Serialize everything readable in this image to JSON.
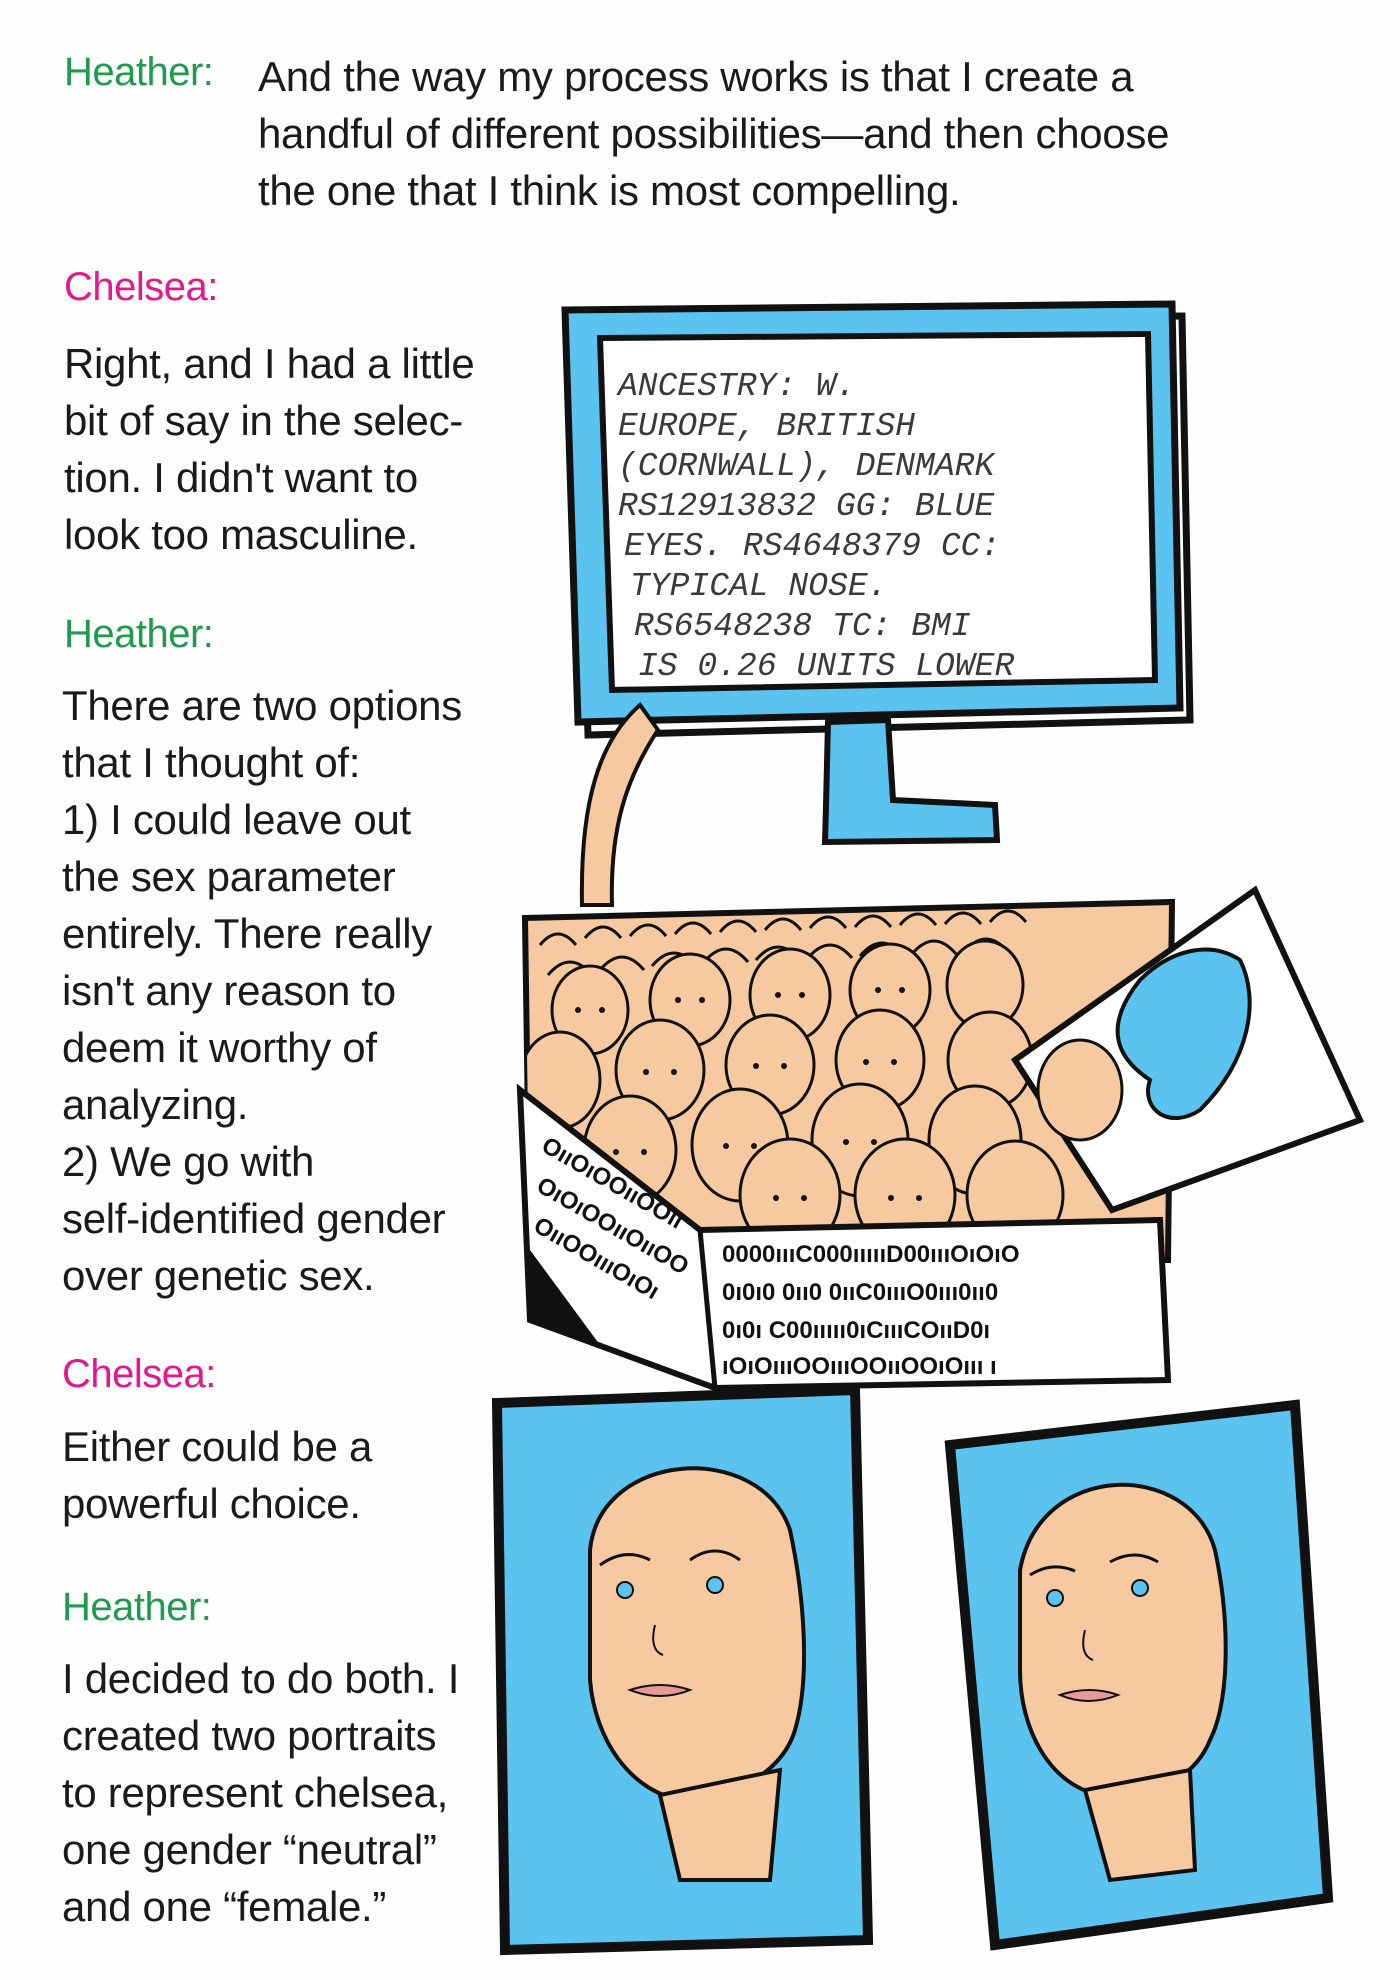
{
  "top": {
    "speaker": "Heather:",
    "lines": [
      "And the way my process works is that I create a",
      "handful of different possibilities—and then choose",
      "the one that I think is most compelling."
    ]
  },
  "dialogue": [
    {
      "speaker": "Chelsea:",
      "lines": [
        "Right, and I had a little",
        "bit of say in the selec-",
        "tion. I didn't want to",
        "look too masculine."
      ]
    },
    {
      "speaker": "Heather:",
      "lines": [
        "There are two options",
        "that I thought of:",
        "1) I could leave out",
        "the sex parameter",
        "entirely. There really",
        "isn't any reason to",
        "deem it worthy of",
        "analyzing.",
        "2) We go with",
        "self-identified gender",
        "over genetic sex."
      ]
    },
    {
      "speaker": "Chelsea:",
      "lines": [
        "Either could be a",
        "powerful choice."
      ]
    },
    {
      "speaker": "Heather:",
      "lines": [
        "I decided to do both. I",
        "created two portraits",
        "to represent chelsea,",
        "one gender “neutral”",
        "and one “female.”"
      ]
    }
  ],
  "monitor_text": [
    "ANCESTRY: W.",
    "EUROPE, BRITISH",
    "(CORNWALL), DENMARK",
    "RS12913832 GG: BLUE",
    "EYES. RS4648379 CC:",
    "TYPICAL NOSE.",
    "RS6548238 TC:  BMI",
    "IS 0.26 UNITS LOWER"
  ],
  "binary_rows": [
    "0000ıııC000ıııııD00ıııOıOıO",
    "0ı0ı0 0ıı0 0ııC0ıııO0ııı0ıı0",
    "0ı0ı C00ııııı0ıCıııCOııD0ı",
    "ıOıOıııOOıııOOııOOıOııı ı",
    "OııOıOOııOOıı",
    "OıOıOOııOııOO",
    "OııOOıııOıOı"
  ],
  "colors": {
    "heather": "#1f9a4f",
    "chelsea": "#e6178a",
    "blue": "#5bc3f0",
    "skin": "#f7c9a0"
  }
}
